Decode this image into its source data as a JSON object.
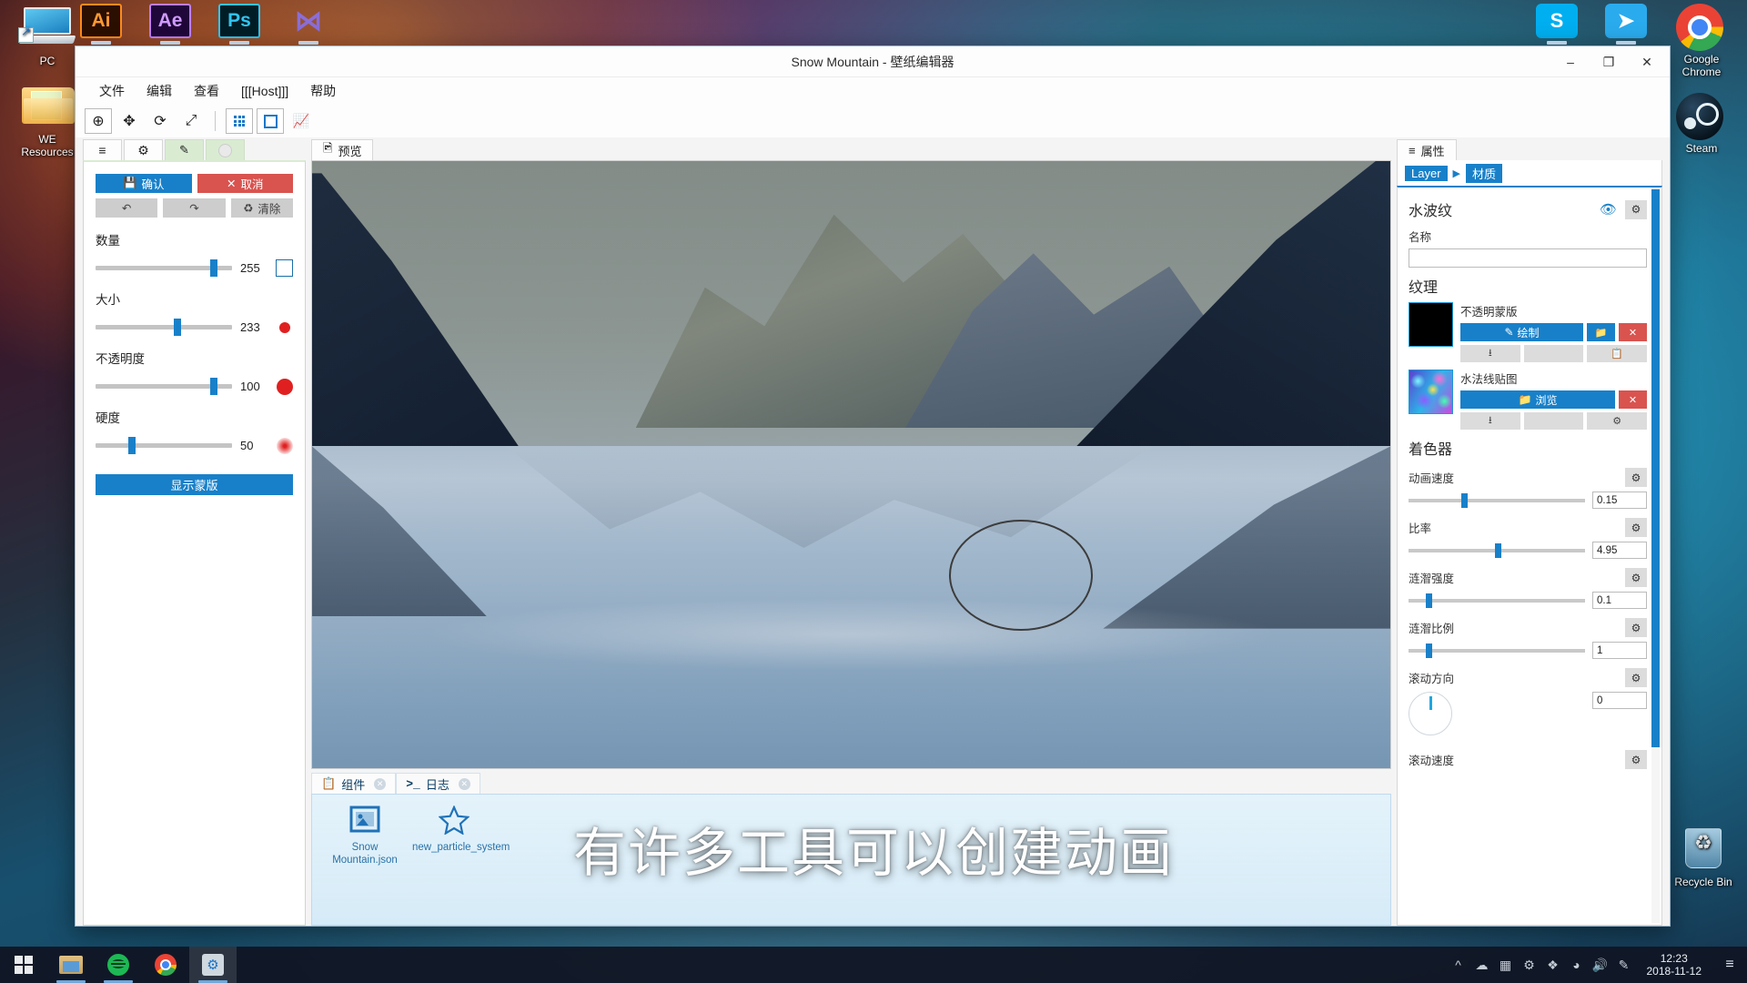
{
  "desktop": {
    "icons": [
      {
        "name": "PC",
        "label": "PC"
      },
      {
        "name": "WE Resources",
        "label": "WE\nResources"
      },
      {
        "name": "Google Chrome",
        "label": "Google\nChrome"
      },
      {
        "name": "Steam",
        "label": "Steam"
      },
      {
        "name": "Recycle Bin",
        "label": "Recycle Bin"
      }
    ],
    "top_apps": [
      {
        "id": "ai",
        "label": "Ai"
      },
      {
        "id": "ae",
        "label": "Ae"
      },
      {
        "id": "ps",
        "label": "Ps"
      },
      {
        "id": "vs",
        "label": "⋈"
      },
      {
        "id": "skype",
        "label": "S"
      },
      {
        "id": "telegram",
        "label": "➤"
      },
      {
        "id": "chrome",
        "label": ""
      }
    ]
  },
  "taskbar": {
    "start_label": "Start",
    "items": [
      {
        "name": "file-explorer",
        "label": "File Explorer"
      },
      {
        "name": "spotify",
        "label": "Spotify"
      },
      {
        "name": "chrome",
        "label": "Google Chrome"
      },
      {
        "name": "wallpaper-engine",
        "label": "Wallpaper Engine"
      }
    ],
    "tray_icons": [
      "chevron-up",
      "onedrive",
      "app",
      "wallpaper-engine",
      "dropbox",
      "network",
      "volume",
      "pen"
    ],
    "clock_time": "12:23",
    "clock_date": "2018-11-12",
    "notification_icon": "≡"
  },
  "window": {
    "title": "Snow Mountain - 壁纸编辑器",
    "controls": {
      "minimize": "–",
      "maximize": "❐",
      "close": "✕"
    },
    "menu": [
      "文件",
      "编辑",
      "查看",
      "[[[Host]]]",
      "帮助"
    ],
    "toolbar": [
      {
        "name": "pan-select-tool",
        "glyph": "⊕",
        "selected": true
      },
      {
        "name": "move-tool",
        "glyph": "✥",
        "selected": false
      },
      {
        "name": "rotate-tool",
        "glyph": "⟳",
        "selected": false
      },
      {
        "name": "scale-tool",
        "glyph": "⤢",
        "selected": false
      },
      {
        "name": "grid-toggle",
        "glyph": "grid",
        "selected": false
      },
      {
        "name": "bounds-toggle",
        "glyph": "square",
        "selected": false
      },
      {
        "name": "graph-tool",
        "glyph": "↗",
        "selected": false
      }
    ]
  },
  "left_panel": {
    "tabs": [
      {
        "name": "layers",
        "glyph": "≡",
        "active": false
      },
      {
        "name": "settings",
        "glyph": "⚙",
        "active": false
      },
      {
        "name": "brush",
        "glyph": "🖌",
        "active": true
      },
      {
        "name": "eraser",
        "glyph": "",
        "active": true
      }
    ],
    "confirm_label": "确认",
    "cancel_label": "取消",
    "undo_label": "↶",
    "redo_label": "↷",
    "clear_label": "清除",
    "sliders": [
      {
        "label": "数量",
        "value": "255",
        "pct": 84,
        "swatch": "square",
        "swatch_color": "#ffffff"
      },
      {
        "label": "大小",
        "value": "233",
        "pct": 57,
        "swatch": "circle",
        "swatch_color": "#e02020",
        "size": 12
      },
      {
        "label": "不透明度",
        "value": "100",
        "pct": 84,
        "swatch": "circle",
        "swatch_color": "#e02020",
        "size": 17
      },
      {
        "label": "硬度",
        "value": "50",
        "pct": 40,
        "swatch": "soft",
        "swatch_color": "#e02020",
        "size": 11
      }
    ],
    "show_mask_label": "显示蒙版"
  },
  "center": {
    "preview_tab": "预览",
    "bottom_tabs": [
      {
        "label": "组件",
        "icon": "copy-icon",
        "active": true
      },
      {
        "label": "日志",
        "icon": "terminal-icon",
        "active": false
      }
    ],
    "components": [
      {
        "label": "Snow Mountain.json",
        "icon": "image-icon"
      },
      {
        "label": "new_particle_system",
        "icon": "star-icon"
      }
    ]
  },
  "right_panel": {
    "tab_label": "属性",
    "breadcrumb": [
      "Layer",
      "材质"
    ],
    "layer_name": "水波纹",
    "name_field_label": "名称",
    "name_field_value": "",
    "texture_section": "纹理",
    "textures": [
      {
        "name": "不透明蒙版",
        "thumb": "black",
        "primary_label": "绘制",
        "primary_icon": "brush-icon",
        "has_folder_button": true,
        "has_delete_button": true,
        "row2": [
          "import-icon",
          "export-icon",
          "copy-icon"
        ]
      },
      {
        "name": "水法线贴图",
        "thumb": "caustic",
        "primary_label": "浏览",
        "primary_icon": "folder-icon",
        "has_folder_button": false,
        "has_delete_button": true,
        "row2": [
          "import-icon",
          "export-icon",
          "gear-icon"
        ]
      }
    ],
    "shader_section": "着色器",
    "properties": [
      {
        "label": "动画速度",
        "value": "0.15",
        "pct": 30
      },
      {
        "label": "比率",
        "value": "4.95",
        "pct": 49
      },
      {
        "label": "涟潪强度",
        "value": "0.1",
        "pct": 11
      },
      {
        "label": "涟潪比例",
        "value": "1",
        "pct": 11
      }
    ],
    "scroll_direction": {
      "label": "滚动方向",
      "value": "0"
    },
    "scroll_speed": {
      "label": "滚动速度"
    }
  },
  "subtitle": "有许多工具可以创建动画",
  "colors": {
    "accent": "#1880c9",
    "danger": "#d9534f",
    "brush_tab": "#d9ecd2"
  }
}
